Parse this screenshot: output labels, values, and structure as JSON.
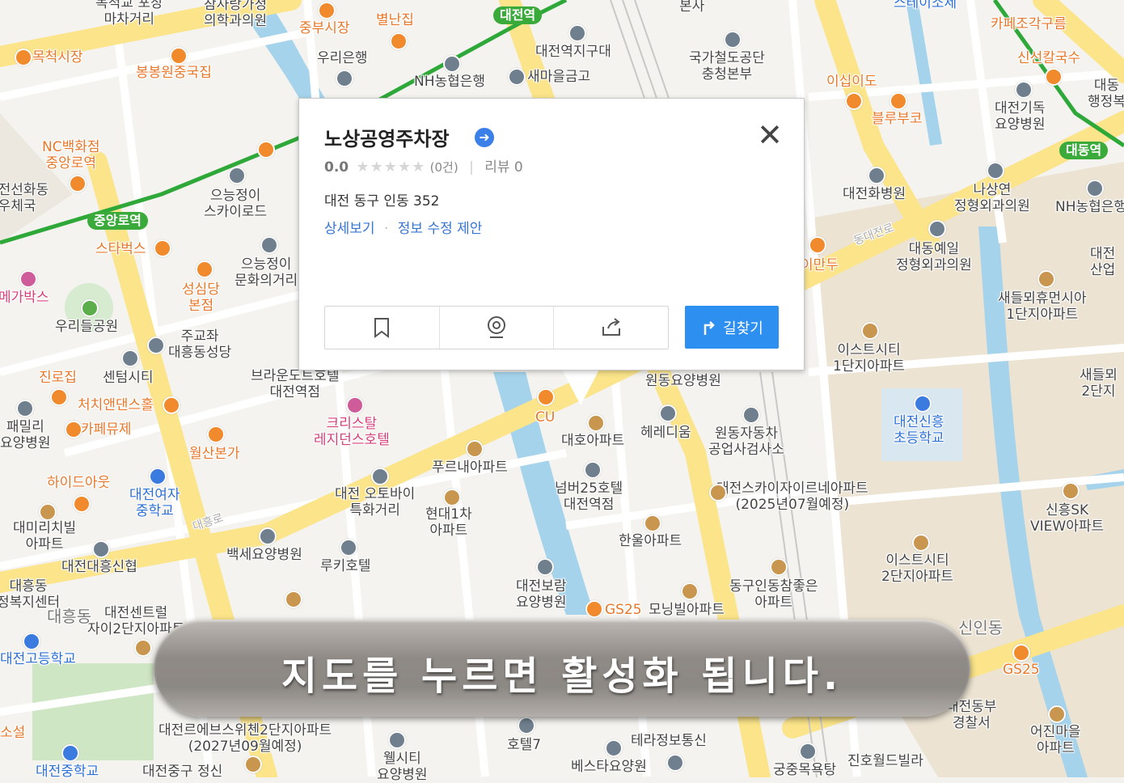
{
  "popup": {
    "title": "노상공영주차장",
    "verified_icon": "arrow-right-circle",
    "score": "0.0",
    "stars": "★★★★★",
    "review_count": "(0건)",
    "reviews": "리뷰 0",
    "address": "대전 동구 인동 352",
    "link_detail": "상세보기",
    "link_edit": "정보 수정 제안",
    "btn_save_icon": "bookmark-icon",
    "btn_roadview_icon": "roadview-icon",
    "btn_share_icon": "share-icon",
    "route_label": "길찾기",
    "close_icon": "close-icon"
  },
  "banner": {
    "text": "지도를 누르면 활성화 됩니다."
  },
  "map": {
    "colors": {
      "major_road": "#fbe48a",
      "minor_road": "#ffffff",
      "river": "#9fd0ea",
      "subway_line": "#2fa83a",
      "residential": "#ece3d3",
      "park": "#cfe6c4"
    },
    "stations": [
      "대전역",
      "중앙로역",
      "대동역"
    ],
    "labels": [
      "목척교 포장\n마차거리",
      "참사랑가정\n의학과의원",
      "중부시장",
      "별난집",
      "본사",
      "스테이소제",
      "카페조각구름",
      "목척시장",
      "우리은행",
      "대전역지구대",
      "국가철도공단\n충청본부",
      "신선칼국수",
      "대동\n행정복",
      "봉봉원중국집",
      "NH농협은행",
      "새마을금고",
      "이십이도",
      "대전기독\n요양병원",
      "NC백화점\n중앙로역",
      "블루부코",
      "대전선화동\n우체국",
      "으능정이\n스카이로드",
      "대전화병원",
      "나상연\n정형외과의원",
      "NH농협은행",
      "스타벅스",
      "동대전로",
      "대동예일\n정형외과의원",
      "대전\n산업",
      "메가박스",
      "성심당\n본점",
      "으능정이\n문화의거리",
      "이만두",
      "새들뫼휴먼시아\n1단지아파트",
      "우리들공원",
      "주교좌\n대흥동성당",
      "이스트시티\n1단지아파트",
      "진로집",
      "센텀시티",
      "브라운도트호텔\n대전역점",
      "원동요양병원",
      "새들뫼\n2단지",
      "처치앤댄스홀",
      "대전신흥\n초등학교",
      "패밀리\n요양병원",
      "카페뮤제",
      "크리스탈\n레지던스호텔",
      "CU",
      "헤레디움",
      "대호아파트",
      "원동자동차\n공업사검사소",
      "월산본가",
      "푸르내아파트",
      "하이드아웃",
      "대전여자\n중학교",
      "대전 오토바이\n특화거리",
      "넘버25호텔\n대전역점",
      "대전스카이자이르네아파트\n(2025년07월예정)",
      "신흥SK\nVIEW아파트",
      "대미리치빌\n아파트",
      "현대1차\n아파트",
      "대흥로",
      "한울아파트",
      "백세요양병원",
      "이스트시티\n2단지아파트",
      "대전대흥신협",
      "루키호텔",
      "대전보람\n요양병원",
      "동구인동참좋은\n아파트",
      "대흥동\n정복지센터",
      "대전센트럴\n자이2단지아파트",
      "GS25",
      "모닝빌아파트",
      "대흥동",
      "신인동",
      "대전고등학교",
      "대전르에브스위첸2단지아파트\n(2027년09월예정)",
      "호텔7",
      "대전동부\n경찰서",
      "어진마을\n아파트",
      "테라정보통신",
      "웰시티\n요양병원",
      "베스타요양원",
      "궁중목욕탕",
      "진호월드빌라",
      "대전중학교",
      "대전중구 정신",
      "소설"
    ]
  }
}
